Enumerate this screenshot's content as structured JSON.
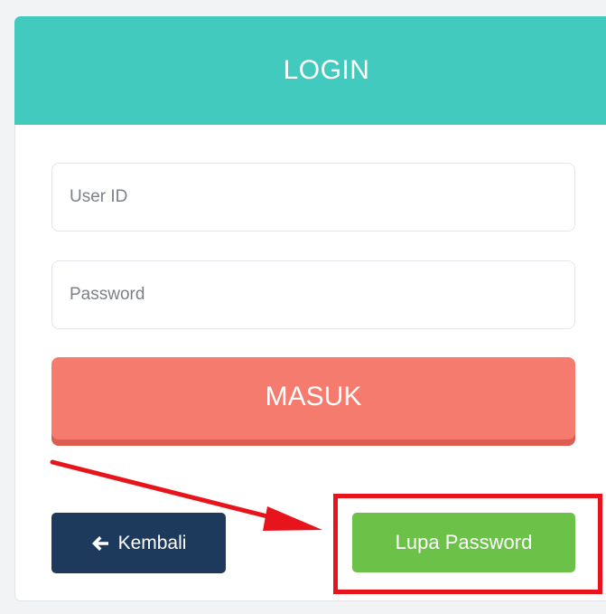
{
  "header": {
    "title": "LOGIN"
  },
  "form": {
    "user_id_placeholder": "User ID",
    "user_id_value": "",
    "password_placeholder": "Password",
    "password_value": "",
    "submit_label": "MASUK"
  },
  "actions": {
    "back_label": "Kembali",
    "back_icon": "arrow-left-icon",
    "forgot_label": "Lupa Password"
  },
  "annotation": {
    "arrow_icon": "red-arrow-icon",
    "highlight": "red-highlight-box"
  },
  "colors": {
    "header": "#43cabf",
    "submit": "#f47b6e",
    "back": "#1d3a5c",
    "forgot": "#6cc248",
    "annotation": "#e8141b"
  }
}
